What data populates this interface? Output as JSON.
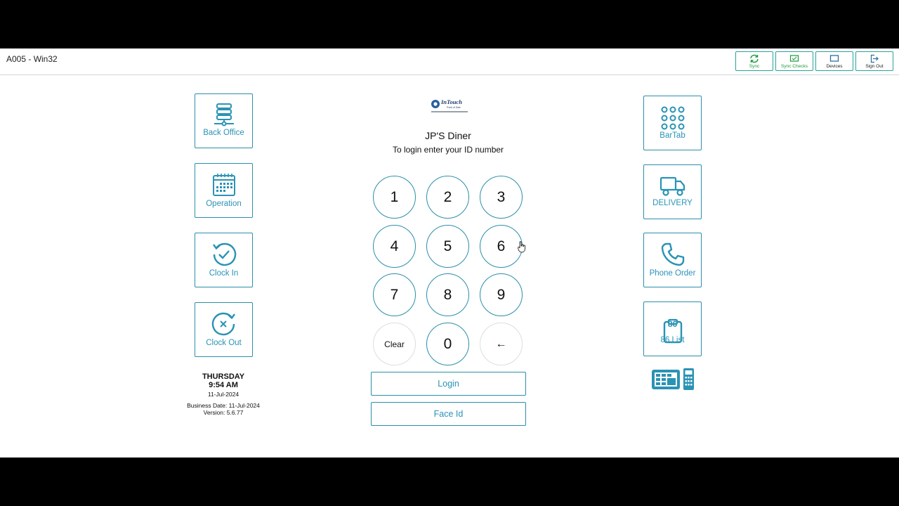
{
  "window": {
    "title": "A005 - Win32"
  },
  "header_buttons": [
    {
      "label": "Sync",
      "icon": "sync-icon"
    },
    {
      "label": "Sync Checks",
      "icon": "sync-checks-icon"
    },
    {
      "label": "Devices",
      "icon": "devices-icon"
    },
    {
      "label": "Sign Out",
      "icon": "sign-out-icon"
    }
  ],
  "left_tiles": [
    {
      "label": "Back Office",
      "icon": "server-icon"
    },
    {
      "label": "Operation",
      "icon": "calendar-icon"
    },
    {
      "label": "Clock In",
      "icon": "clock-in-icon"
    },
    {
      "label": "Clock Out",
      "icon": "clock-out-icon"
    }
  ],
  "right_tiles": [
    {
      "label": "BarTab",
      "icon": "dots-grid-icon"
    },
    {
      "label": "DELIVERY",
      "icon": "truck-icon"
    },
    {
      "label": "Phone Order",
      "icon": "phone-icon"
    },
    {
      "label": "86 List",
      "icon": "clipboard-86-icon",
      "badge": "86"
    }
  ],
  "info": {
    "day": "THURSDAY",
    "time": "9:54 AM",
    "date": "11-Jul-2024",
    "business_date": "Business Date: 11-Jul-2024",
    "version": "Version: 5.6.77"
  },
  "logo": {
    "brand": "InTouch",
    "tagline": "Point of Sale"
  },
  "login": {
    "store_name": "JP'S Diner",
    "prompt": "To login enter your ID number",
    "keys": [
      "1",
      "2",
      "3",
      "4",
      "5",
      "6",
      "7",
      "8",
      "9",
      "Clear",
      "0",
      "←"
    ],
    "login_label": "Login",
    "face_id_label": "Face Id"
  },
  "colors": {
    "accent": "#2a93b5",
    "border": "#2a8fab",
    "sync_green": "#1c9a3a"
  }
}
